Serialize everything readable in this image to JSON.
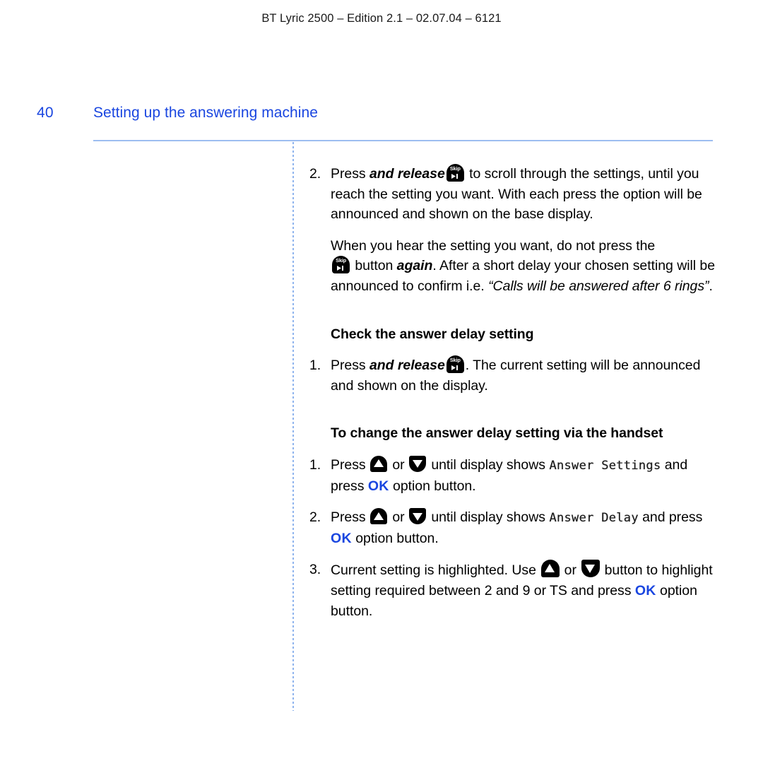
{
  "header": {
    "running_head": "BT Lyric 2500 – Edition 2.1 – 02.07.04 – 6121"
  },
  "title_row": {
    "page_number": "40",
    "chapter_title": "Setting up the answering machine",
    "accent_color": "#1a46e0"
  },
  "icons": {
    "skip_label": "Skip",
    "skip_name": "skip-button-icon",
    "up_name": "up-arrow-key-icon",
    "down_name": "down-arrow-key-icon"
  },
  "content": {
    "item2": {
      "number": "2.",
      "text_before": "Press ",
      "emphasis": "and release",
      "text_after": " to scroll through the settings, until you reach the setting you want. With each press the option will be announced and shown on the base display."
    },
    "para_note": {
      "line1": "When you hear the setting you want, do not press the",
      "after_icon_before_em": " button ",
      "emphasis": "again",
      "after_em": ". After a short delay your chosen setting will be announced to confirm i.e. ",
      "quote": "“Calls will be answered after 6 rings”",
      "tail": "."
    },
    "heading1": "Check the answer delay setting",
    "check_item1": {
      "number": "1.",
      "text_before": "Press ",
      "emphasis": "and release",
      "text_after": ". The current setting will be announced and shown on the display."
    },
    "heading2": "To change the answer delay setting via the handset",
    "handset_item1": {
      "number": "1.",
      "t1": "Press ",
      "or": " or ",
      "t2": " until display shows ",
      "display": "Answer Settings",
      "t3": " and press ",
      "ok": "OK",
      "t4": " option button."
    },
    "handset_item2": {
      "number": "2.",
      "t1": "Press ",
      "or": " or ",
      "t2": " until display shows ",
      "display": "Answer Delay",
      "t3": " and press ",
      "ok": "OK",
      "t4": " option button."
    },
    "handset_item3": {
      "number": "3.",
      "t1": "Current setting is highlighted. Use ",
      "or": " or ",
      "t2": " button to highlight setting required between 2 and 9 or TS and press ",
      "ok": "OK",
      "t3": " option button."
    }
  }
}
